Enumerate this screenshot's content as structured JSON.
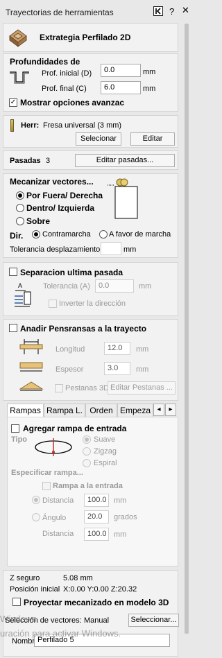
{
  "titlebar": {
    "title": "Trayectorias de herramientas",
    "help": "?"
  },
  "header": {
    "title": "Extrategia Perfilado 2D"
  },
  "depths": {
    "heading": "Profundidades de",
    "start_label": "Prof. inicial (D)",
    "start_value": "0.0",
    "start_unit": "mm",
    "end_label": "Prof. final (C)",
    "end_value": "6.0",
    "end_unit": "mm",
    "advanced_label": "Mostrar opciones avanzac",
    "advanced_checked": true
  },
  "tool": {
    "label": "Herr:",
    "name": "Fresa universal (3 mm)",
    "select_button": "Selecionar",
    "edit_button": "Editar"
  },
  "passes": {
    "label": "Pasadas",
    "count": "3",
    "edit_button": "Editar pasadas..."
  },
  "machine_vectors": {
    "heading": "Mecanizar vectores...",
    "options": [
      "Por Fuera/ Derecha",
      "Dentro/ Izquierda",
      "Sobre"
    ],
    "selected": 0,
    "dir_label": "Dir.",
    "dir_options": [
      "Contramarcha",
      "A favor de marcha"
    ],
    "dir_selected": 0,
    "tolerance_label": "Tolerancia desplazamiento",
    "tolerance_unit": "mm"
  },
  "last_pass": {
    "label": "Separacion ultima pasada",
    "tolerance_label": "Tolerancia (A)",
    "tolerance_value": "0.0",
    "tolerance_unit": "mm",
    "invert_label": "Inverter la dirección"
  },
  "tabs_section": {
    "label": "Anadir Pensransas a la trayecto",
    "length_label": "Longitud",
    "length_value": "12.0",
    "length_unit": "mm",
    "thickness_label": "Espesor",
    "thickness_value": "3.0",
    "thickness_unit": "mm",
    "tabs3d_label": "Pestanas 3D",
    "edit_tabs_button": "Editar Pestanas ..."
  },
  "tab_bar": {
    "tabs": [
      "Rampas",
      "Rampa L.",
      "Orden",
      "Empeza"
    ],
    "active": 0,
    "prev": "◂",
    "next": "▸"
  },
  "ramps": {
    "add_label": "Agregar rampa de entrada",
    "type_label": "Tipo",
    "type_options": [
      "Suave",
      "Zigzag",
      "Espiral"
    ],
    "specify_label": "Especificar rampa...",
    "ramp_in_label": "Rampa a la entrada",
    "distance_label": "Distancia",
    "distance_value": "100.0",
    "distance_unit": "mm",
    "angle_label": "Ángulo",
    "angle_value": "20.0",
    "angle_unit": "grados",
    "distance2_label": "Distancia",
    "distance2_value": "100.0",
    "distance2_unit": "mm"
  },
  "footer": {
    "z_safe_label": "Z seguro",
    "z_safe_value": "5.08 mm",
    "home_label": "Posición inicial",
    "home_value": "X:0.00 Y:0.00 Z:20.32",
    "project_label": "Proyectar mecanizado en modelo 3D",
    "vector_sel_label": "Selección de vectores:",
    "vector_sel_value": "Manual",
    "vector_sel_button": "Seleccionar...",
    "name_label": "Nombre:",
    "name_value": "Perfilado 5"
  },
  "watermark": {
    "line1": "Windows",
    "line2": "uración para activar Windows."
  }
}
